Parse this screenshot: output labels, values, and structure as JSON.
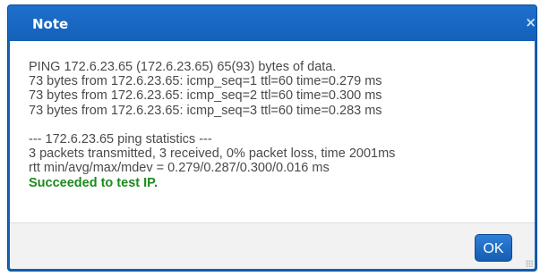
{
  "dialog": {
    "title": "Note",
    "close_glyph": "×",
    "close_icon": "close-icon",
    "ok_label": "OK",
    "accent_color": "#1661b8",
    "success_color": "#1d8a1d"
  },
  "message": {
    "lines": [
      "PING 172.6.23.65 (172.6.23.65) 65(93) bytes of data.",
      "73 bytes from 172.6.23.65: icmp_seq=1 ttl=60 time=0.279 ms",
      "73 bytes from 172.6.23.65: icmp_seq=2 ttl=60 time=0.300 ms",
      "73 bytes from 172.6.23.65: icmp_seq=3 ttl=60 time=0.283 ms",
      "",
      "--- 172.6.23.65 ping statistics ---",
      "3 packets transmitted, 3 received, 0% packet loss, time 2001ms",
      "rtt min/avg/max/mdev = 0.279/0.287/0.300/0.016 ms"
    ],
    "status": "Succeeded to test IP."
  }
}
